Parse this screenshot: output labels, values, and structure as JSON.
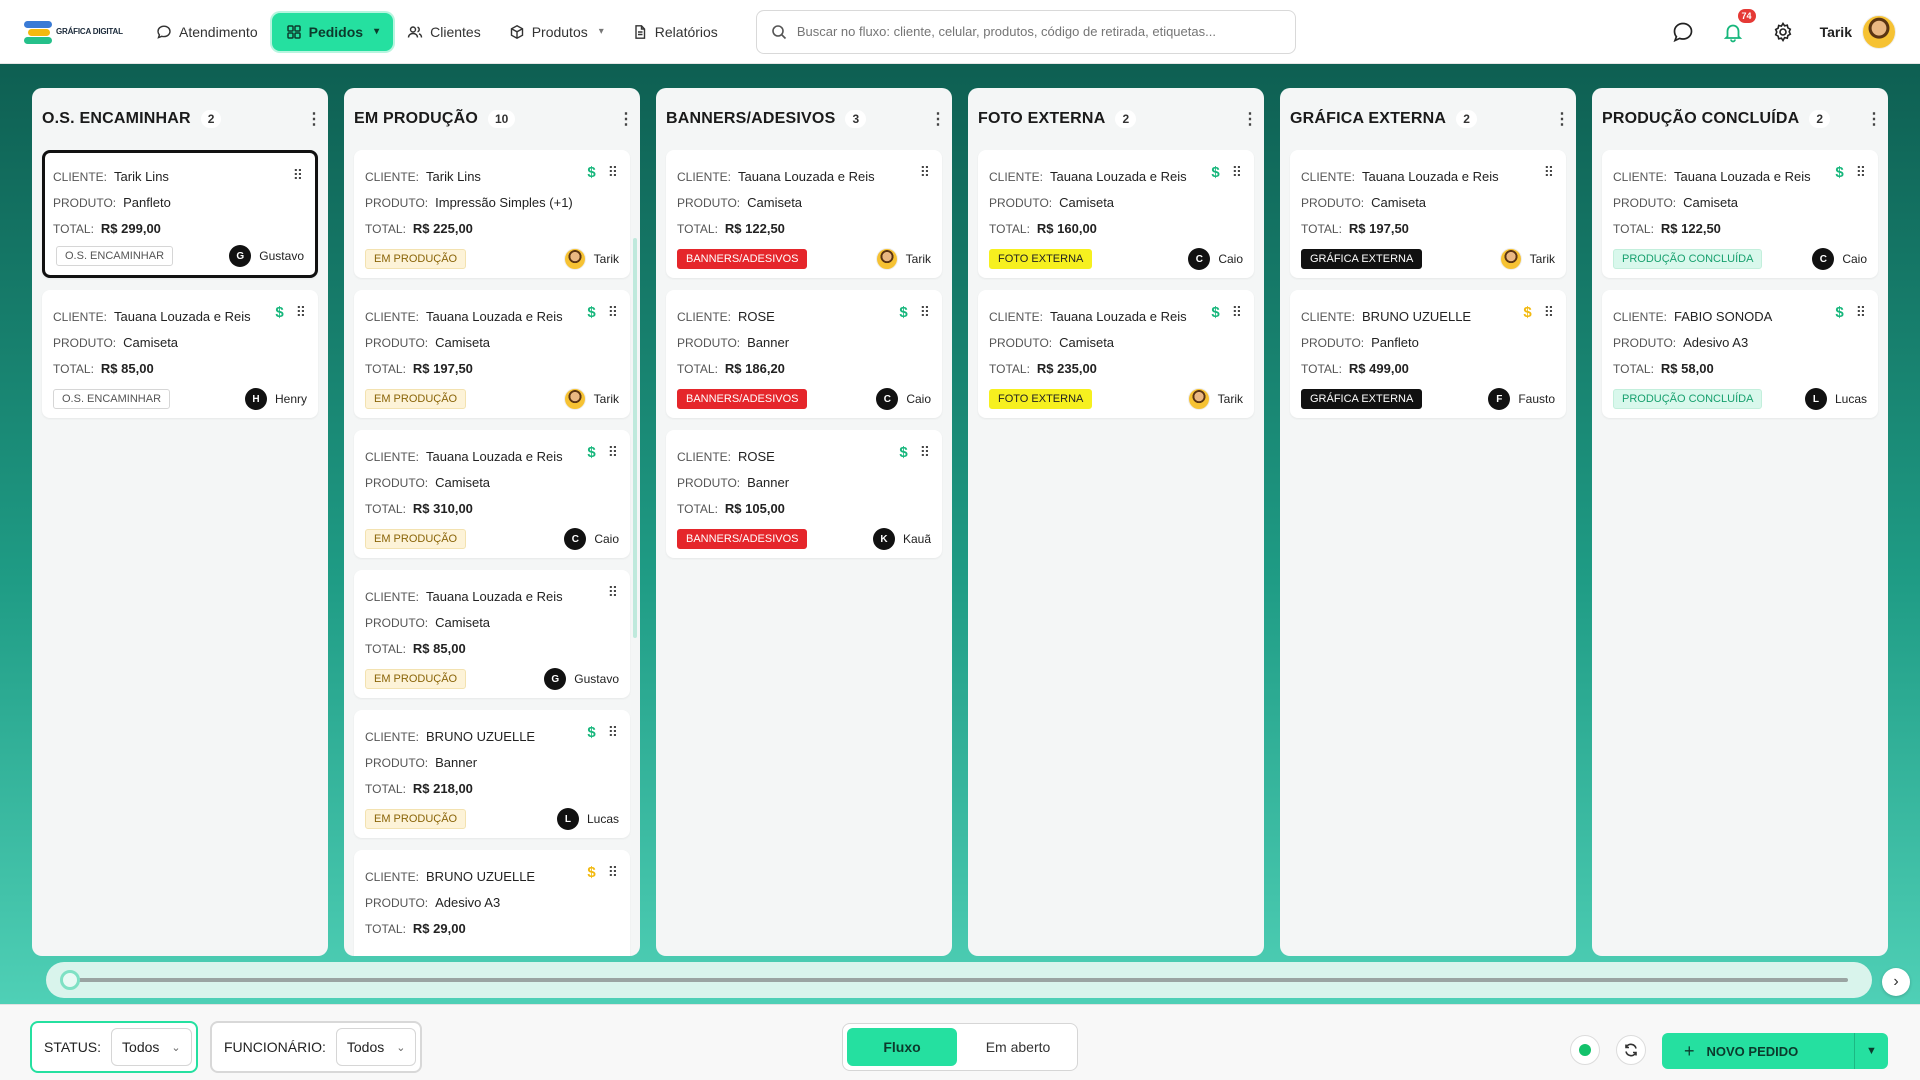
{
  "app": {
    "logo_text": "GRÁFICA DIGITAL"
  },
  "nav": [
    {
      "label": "Atendimento",
      "icon": "chat-bubble-icon",
      "active": false
    },
    {
      "label": "Pedidos",
      "icon": "grid-icon",
      "active": true,
      "dropdown": true
    },
    {
      "label": "Clientes",
      "icon": "users-icon",
      "active": false
    },
    {
      "label": "Produtos",
      "icon": "box-icon",
      "active": false,
      "dropdown": true
    },
    {
      "label": "Relatórios",
      "icon": "document-icon",
      "active": false
    }
  ],
  "search": {
    "placeholder": "Buscar no fluxo: cliente, celular, produtos, código de retirada, etiquetas..."
  },
  "header": {
    "notifications": "74",
    "user_name": "Tarik"
  },
  "labels": {
    "client": "CLIENTE:",
    "product": "PRODUTO:",
    "total": "TOTAL:"
  },
  "columns": [
    {
      "title": "O.S. ENCAMINHAR",
      "count": "2",
      "tag_bg": "#ffffff",
      "tag_fg": "#555555",
      "tag_border": "#d6d6d6",
      "cards": [
        {
          "client": "Tarik Lins",
          "product": "Panfleto",
          "total": "R$ 299,00",
          "tag": "O.S. ENCAMINHAR",
          "assignee": "Gustavo",
          "initial": "G",
          "photo": false,
          "dollar": "",
          "selected": true
        },
        {
          "client": "Tauana Louzada e Reis",
          "product": "Camiseta",
          "total": "R$ 85,00",
          "tag": "O.S. ENCAMINHAR",
          "assignee": "Henry",
          "initial": "H",
          "photo": false,
          "dollar": "green",
          "selected": false
        }
      ]
    },
    {
      "title": "EM PRODUÇÃO",
      "count": "10",
      "tag_bg": "#fdf3d8",
      "tag_fg": "#8a6508",
      "tag_border": "#f3e2b0",
      "cards": [
        {
          "client": "Tarik Lins",
          "product": "Impressão Simples (+1)",
          "total": "R$ 225,00",
          "tag": "EM PRODUÇÃO",
          "assignee": "Tarik",
          "initial": "T",
          "photo": true,
          "dollar": "green"
        },
        {
          "client": "Tauana Louzada e Reis",
          "product": "Camiseta",
          "total": "R$ 197,50",
          "tag": "EM PRODUÇÃO",
          "assignee": "Tarik",
          "initial": "T",
          "photo": true,
          "dollar": "green"
        },
        {
          "client": "Tauana Louzada e Reis",
          "product": "Camiseta",
          "total": "R$ 310,00",
          "tag": "EM PRODUÇÃO",
          "assignee": "Caio",
          "initial": "C",
          "photo": false,
          "dollar": "green"
        },
        {
          "client": "Tauana Louzada e Reis",
          "product": "Camiseta",
          "total": "R$ 85,00",
          "tag": "EM PRODUÇÃO",
          "assignee": "Gustavo",
          "initial": "G",
          "photo": false,
          "dollar": ""
        },
        {
          "client": "BRUNO UZUELLE",
          "product": "Banner",
          "total": "R$ 218,00",
          "tag": "EM PRODUÇÃO",
          "assignee": "Lucas",
          "initial": "L",
          "photo": false,
          "dollar": "green"
        },
        {
          "client": "BRUNO UZUELLE",
          "product": "Adesivo A3",
          "total": "R$ 29,00",
          "tag": "",
          "assignee": "",
          "initial": "",
          "photo": false,
          "dollar": "warn"
        }
      ]
    },
    {
      "title": "BANNERS/ADESIVOS",
      "count": "3",
      "tag_bg": "#e5262b",
      "tag_fg": "#ffffff",
      "tag_border": "#e5262b",
      "cards": [
        {
          "client": "Tauana Louzada e Reis",
          "product": "Camiseta",
          "total": "R$ 122,50",
          "tag": "BANNERS/ADESIVOS",
          "assignee": "Tarik",
          "initial": "T",
          "photo": true,
          "dollar": ""
        },
        {
          "client": "ROSE",
          "product": "Banner",
          "total": "R$ 186,20",
          "tag": "BANNERS/ADESIVOS",
          "assignee": "Caio",
          "initial": "C",
          "photo": false,
          "dollar": "green"
        },
        {
          "client": "ROSE",
          "product": "Banner",
          "total": "R$ 105,00",
          "tag": "BANNERS/ADESIVOS",
          "assignee": "Kauã",
          "initial": "K",
          "photo": false,
          "dollar": "green"
        }
      ]
    },
    {
      "title": "FOTO EXTERNA",
      "count": "2",
      "tag_bg": "#f6f01f",
      "tag_fg": "#222222",
      "tag_border": "#f6f01f",
      "cards": [
        {
          "client": "Tauana Louzada e Reis",
          "product": "Camiseta",
          "total": "R$ 160,00",
          "tag": "FOTO EXTERNA",
          "assignee": "Caio",
          "initial": "C",
          "photo": false,
          "dollar": "green"
        },
        {
          "client": "Tauana Louzada e Reis",
          "product": "Camiseta",
          "total": "R$ 235,00",
          "tag": "FOTO EXTERNA",
          "assignee": "Tarik",
          "initial": "T",
          "photo": true,
          "dollar": "green"
        }
      ]
    },
    {
      "title": "GRÁFICA EXTERNA",
      "count": "2",
      "tag_bg": "#111111",
      "tag_fg": "#ffffff",
      "tag_border": "#111111",
      "cards": [
        {
          "client": "Tauana Louzada e Reis",
          "product": "Camiseta",
          "total": "R$ 197,50",
          "tag": "GRÁFICA EXTERNA",
          "assignee": "Tarik",
          "initial": "T",
          "photo": true,
          "dollar": ""
        },
        {
          "client": "BRUNO UZUELLE",
          "product": "Panfleto",
          "total": "R$ 499,00",
          "tag": "GRÁFICA EXTERNA",
          "assignee": "Fausto",
          "initial": "F",
          "photo": false,
          "dollar": "warn"
        }
      ]
    },
    {
      "title": "PRODUÇÃO CONCLUÍDA",
      "count": "2",
      "tag_bg": "#d9f8ec",
      "tag_fg": "#17a06e",
      "tag_border": "#c3efdc",
      "cards": [
        {
          "client": "Tauana Louzada e Reis",
          "product": "Camiseta",
          "total": "R$ 122,50",
          "tag": "PRODUÇÃO CONCLUÍDA",
          "assignee": "Caio",
          "initial": "C",
          "photo": false,
          "dollar": "green"
        },
        {
          "client": "FABIO SONODA",
          "product": "Adesivo A3",
          "total": "R$ 58,00",
          "tag": "PRODUÇÃO CONCLUÍDA",
          "assignee": "Lucas",
          "initial": "L",
          "photo": false,
          "dollar": "green"
        }
      ]
    }
  ],
  "footer": {
    "status_label": "STATUS:",
    "status_value": "Todos",
    "employee_label": "FUNCIONÁRIO:",
    "employee_value": "Todos",
    "view_options": [
      "Fluxo",
      "Em aberto"
    ],
    "new_order": "NOVO PEDIDO"
  },
  "colors": {
    "accent": "#25e0a0",
    "board_top": "#0e5f52",
    "board_bottom": "#4fd0b6"
  }
}
